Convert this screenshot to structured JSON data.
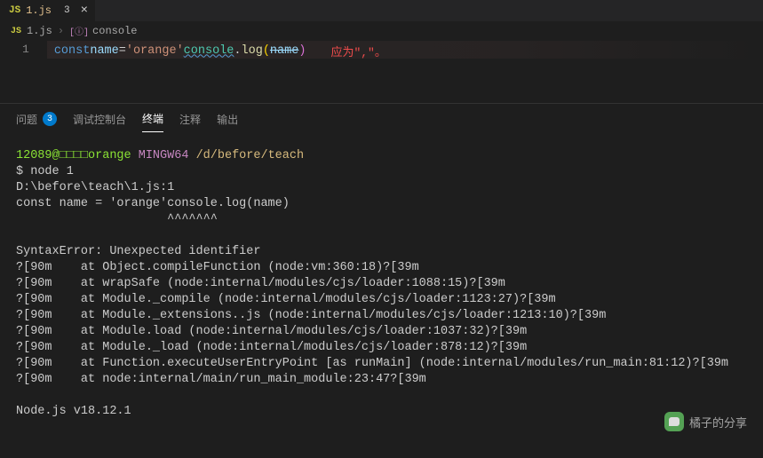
{
  "tab": {
    "filename": "1.js",
    "dirty_indicator": "3",
    "close_glyph": "×"
  },
  "breadcrumb": {
    "file_icon": "JS",
    "filename": "1.js",
    "sep": "›",
    "symbol_icon": "[ⓘ]",
    "symbol": "console"
  },
  "editor": {
    "line_number": "1",
    "tokens": {
      "const": "const",
      "space1": " ",
      "name": "name",
      "sp_eq": " = ",
      "string": "'orange'",
      "console": "console",
      "dot": ".",
      "log": "log",
      "lp": "(",
      "param": "name",
      "rp": ")"
    },
    "hint": "应为\",\"。"
  },
  "panel": {
    "tabs": {
      "problems": "问题",
      "problems_badge": "3",
      "debug": "调试控制台",
      "terminal": "终端",
      "comments": "注释",
      "output": "输出"
    }
  },
  "terminal": {
    "user": "12089@□□□□orange",
    "shell": "MINGW64",
    "path": "/d/before/teach",
    "prompt": "$",
    "command": "node 1",
    "lines": [
      "D:\\before\\teach\\1.js:1",
      "const name = 'orange'console.log(name)",
      "                     ^^^^^^^",
      "",
      "SyntaxError: Unexpected identifier",
      "?[90m    at Object.compileFunction (node:vm:360:18)?[39m",
      "?[90m    at wrapSafe (node:internal/modules/cjs/loader:1088:15)?[39m",
      "?[90m    at Module._compile (node:internal/modules/cjs/loader:1123:27)?[39m",
      "?[90m    at Module._extensions..js (node:internal/modules/cjs/loader:1213:10)?[39m",
      "?[90m    at Module.load (node:internal/modules/cjs/loader:1037:32)?[39m",
      "?[90m    at Module._load (node:internal/modules/cjs/loader:878:12)?[39m",
      "?[90m    at Function.executeUserEntryPoint [as runMain] (node:internal/modules/run_main:81:12)?[39m",
      "?[90m    at node:internal/main/run_main_module:23:47?[39m",
      "",
      "Node.js v18.12.1"
    ]
  },
  "watermark": {
    "text": "橘子的分享"
  }
}
